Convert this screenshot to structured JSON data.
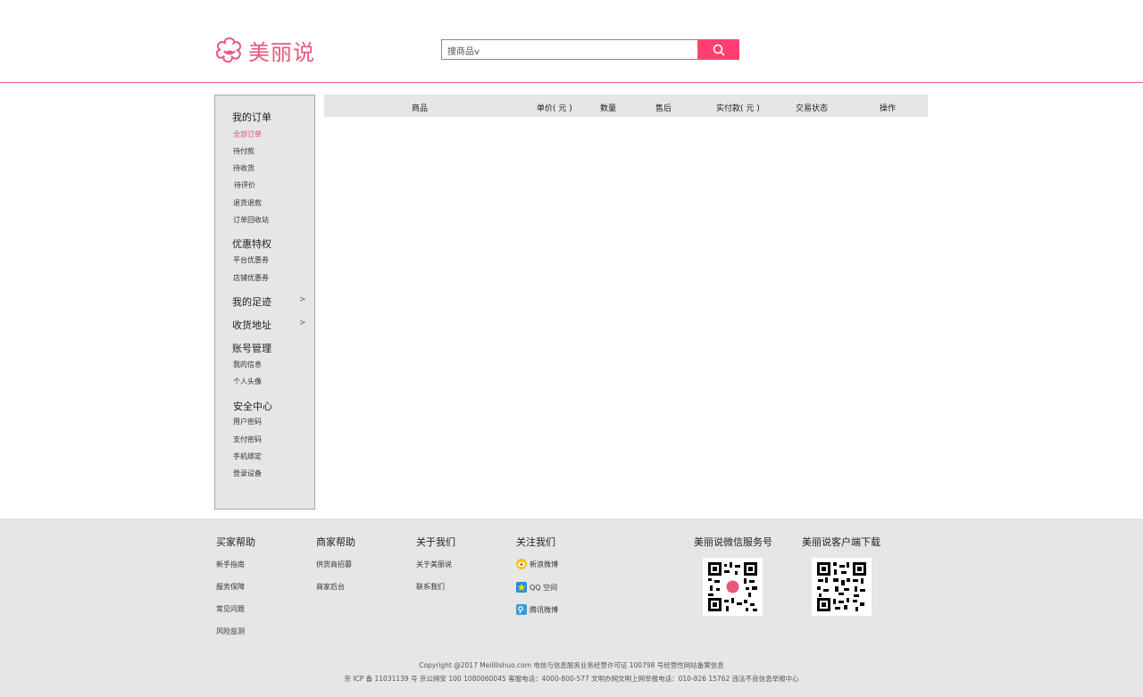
{
  "brand": {
    "name": "美丽说",
    "color": "#e8587d",
    "accent": "#ff3f6f"
  },
  "search": {
    "scope_label": "搜商品v"
  },
  "sidebar": {
    "sections": [
      {
        "title": "我的订单",
        "items": [
          "全部订单",
          "待付款",
          "待收货",
          "待评价",
          "退货退款",
          "订单回收站"
        ]
      },
      {
        "title": "优惠特权",
        "items": [
          "平台优惠券",
          "店铺优惠券"
        ]
      },
      {
        "title": "我的足迹",
        "arrow": ">"
      },
      {
        "title": "收货地址",
        "arrow": ">"
      },
      {
        "title": "账号管理",
        "items": [
          "我的信息",
          "个人头像"
        ]
      },
      {
        "title": "安全中心",
        "items": [
          "用户密码",
          "支付密码",
          "手机绑定",
          "登录设备"
        ]
      }
    ]
  },
  "table": {
    "columns": [
      "商品",
      "单价( 元 )",
      "数量",
      "售后",
      "实付款( 元 )",
      "交易状态",
      "操作"
    ]
  },
  "footer": {
    "buyer_help": {
      "title": "买家帮助",
      "items": [
        "新手指南",
        "服务保障",
        "常见问题",
        "风险监测"
      ]
    },
    "merchant_help": {
      "title": "商家帮助",
      "items": [
        "供货商招募",
        "商家后台"
      ]
    },
    "about": {
      "title": "关于我们",
      "items": [
        "关于美丽说",
        "联系我们"
      ]
    },
    "follow": {
      "title": "关注我们",
      "items": [
        "新浪微博",
        "QQ 空间",
        "腾讯微博"
      ]
    },
    "wechat": {
      "title": "美丽说微信服务号"
    },
    "app": {
      "title": "美丽说客户端下载"
    },
    "copyright_line1": "Copyright @2017 Meililishuo.com 电信与信息服务业务经营许可证 100798 号经营性网站备案信息",
    "copyright_line2": "京 ICP 备 11031139 号 京公网安 100 1080060045  客服电话：4000-800-577 文明办网文明上网举报电话：010-826 15762 违法不良信息举报中心"
  }
}
